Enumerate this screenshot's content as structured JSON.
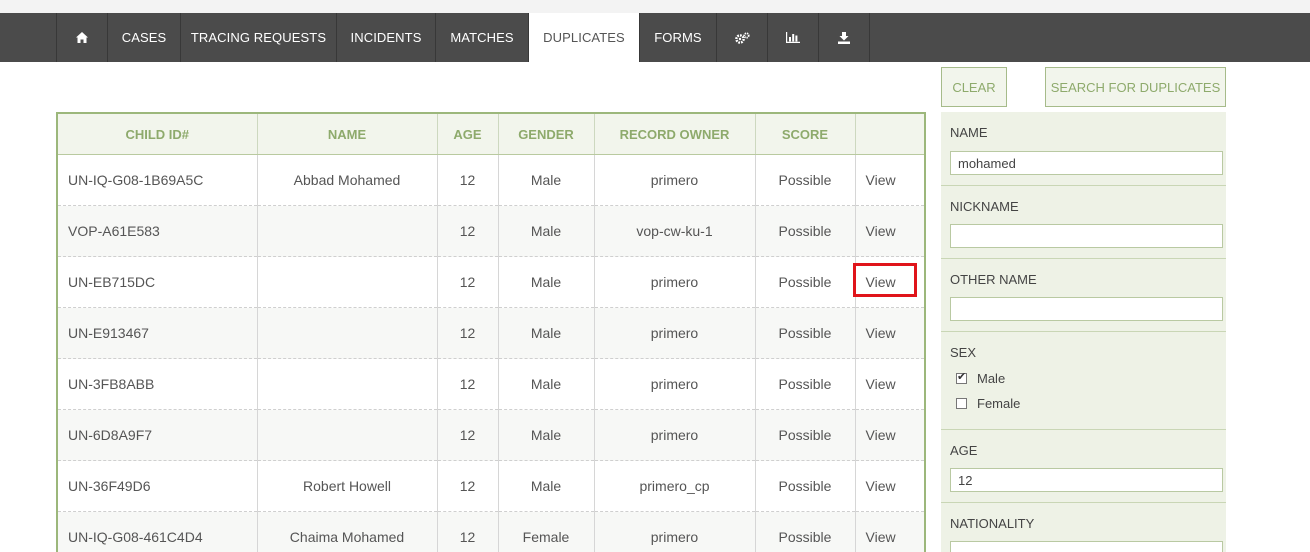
{
  "nav": {
    "items": [
      {
        "key": "home",
        "label": "",
        "icon": "home-icon"
      },
      {
        "key": "cases",
        "label": "CASES"
      },
      {
        "key": "tracing",
        "label": "TRACING REQUESTS"
      },
      {
        "key": "incidents",
        "label": "INCIDENTS"
      },
      {
        "key": "matches",
        "label": "MATCHES"
      },
      {
        "key": "duplicates",
        "label": "DUPLICATES",
        "active": true
      },
      {
        "key": "forms",
        "label": "FORMS"
      },
      {
        "key": "settings",
        "label": "",
        "icon": "gears-icon"
      },
      {
        "key": "reports",
        "label": "",
        "icon": "bar-chart-icon"
      },
      {
        "key": "export",
        "label": "",
        "icon": "download-icon"
      }
    ]
  },
  "table": {
    "headers": [
      "CHILD ID#",
      "NAME",
      "AGE",
      "GENDER",
      "RECORD OWNER",
      "SCORE",
      ""
    ],
    "rows": [
      {
        "id": "UN-IQ-G08-1B69A5C",
        "name": "Abbad Mohamed",
        "age": "12",
        "gender": "Male",
        "owner": "primero",
        "score": "Possible",
        "action": "View"
      },
      {
        "id": "VOP-A61E583",
        "name": "",
        "age": "12",
        "gender": "Male",
        "owner": "vop-cw-ku-1",
        "score": "Possible",
        "action": "View"
      },
      {
        "id": "UN-EB715DC",
        "name": "",
        "age": "12",
        "gender": "Male",
        "owner": "primero",
        "score": "Possible",
        "action": "View"
      },
      {
        "id": "UN-E913467",
        "name": "",
        "age": "12",
        "gender": "Male",
        "owner": "primero",
        "score": "Possible",
        "action": "View"
      },
      {
        "id": "UN-3FB8ABB",
        "name": "",
        "age": "12",
        "gender": "Male",
        "owner": "primero",
        "score": "Possible",
        "action": "View"
      },
      {
        "id": "UN-6D8A9F7",
        "name": "",
        "age": "12",
        "gender": "Male",
        "owner": "primero",
        "score": "Possible",
        "action": "View"
      },
      {
        "id": "UN-36F49D6",
        "name": "Robert Howell",
        "age": "12",
        "gender": "Male",
        "owner": "primero_cp",
        "score": "Possible",
        "action": "View"
      },
      {
        "id": "UN-IQ-G08-461C4D4",
        "name": "Chaima Mohamed",
        "age": "12",
        "gender": "Female",
        "owner": "primero",
        "score": "Possible",
        "action": "View"
      }
    ]
  },
  "filters": {
    "clear_label": "CLEAR",
    "search_label": "SEARCH FOR DUPLICATES",
    "name_label": "NAME",
    "name_value": "mohamed",
    "nickname_label": "NICKNAME",
    "nickname_value": "",
    "other_name_label": "OTHER NAME",
    "other_name_value": "",
    "sex_label": "SEX",
    "sex_options": [
      {
        "label": "Male",
        "checked": true
      },
      {
        "label": "Female",
        "checked": false
      }
    ],
    "age_label": "AGE",
    "age_value": "12",
    "nationality_label": "NATIONALITY"
  },
  "colors": {
    "nav_bg": "#4b4b4b",
    "accent_green": "#8eaa6c",
    "panel_bg": "#eef2e6",
    "highlight_red": "#e0141a"
  }
}
